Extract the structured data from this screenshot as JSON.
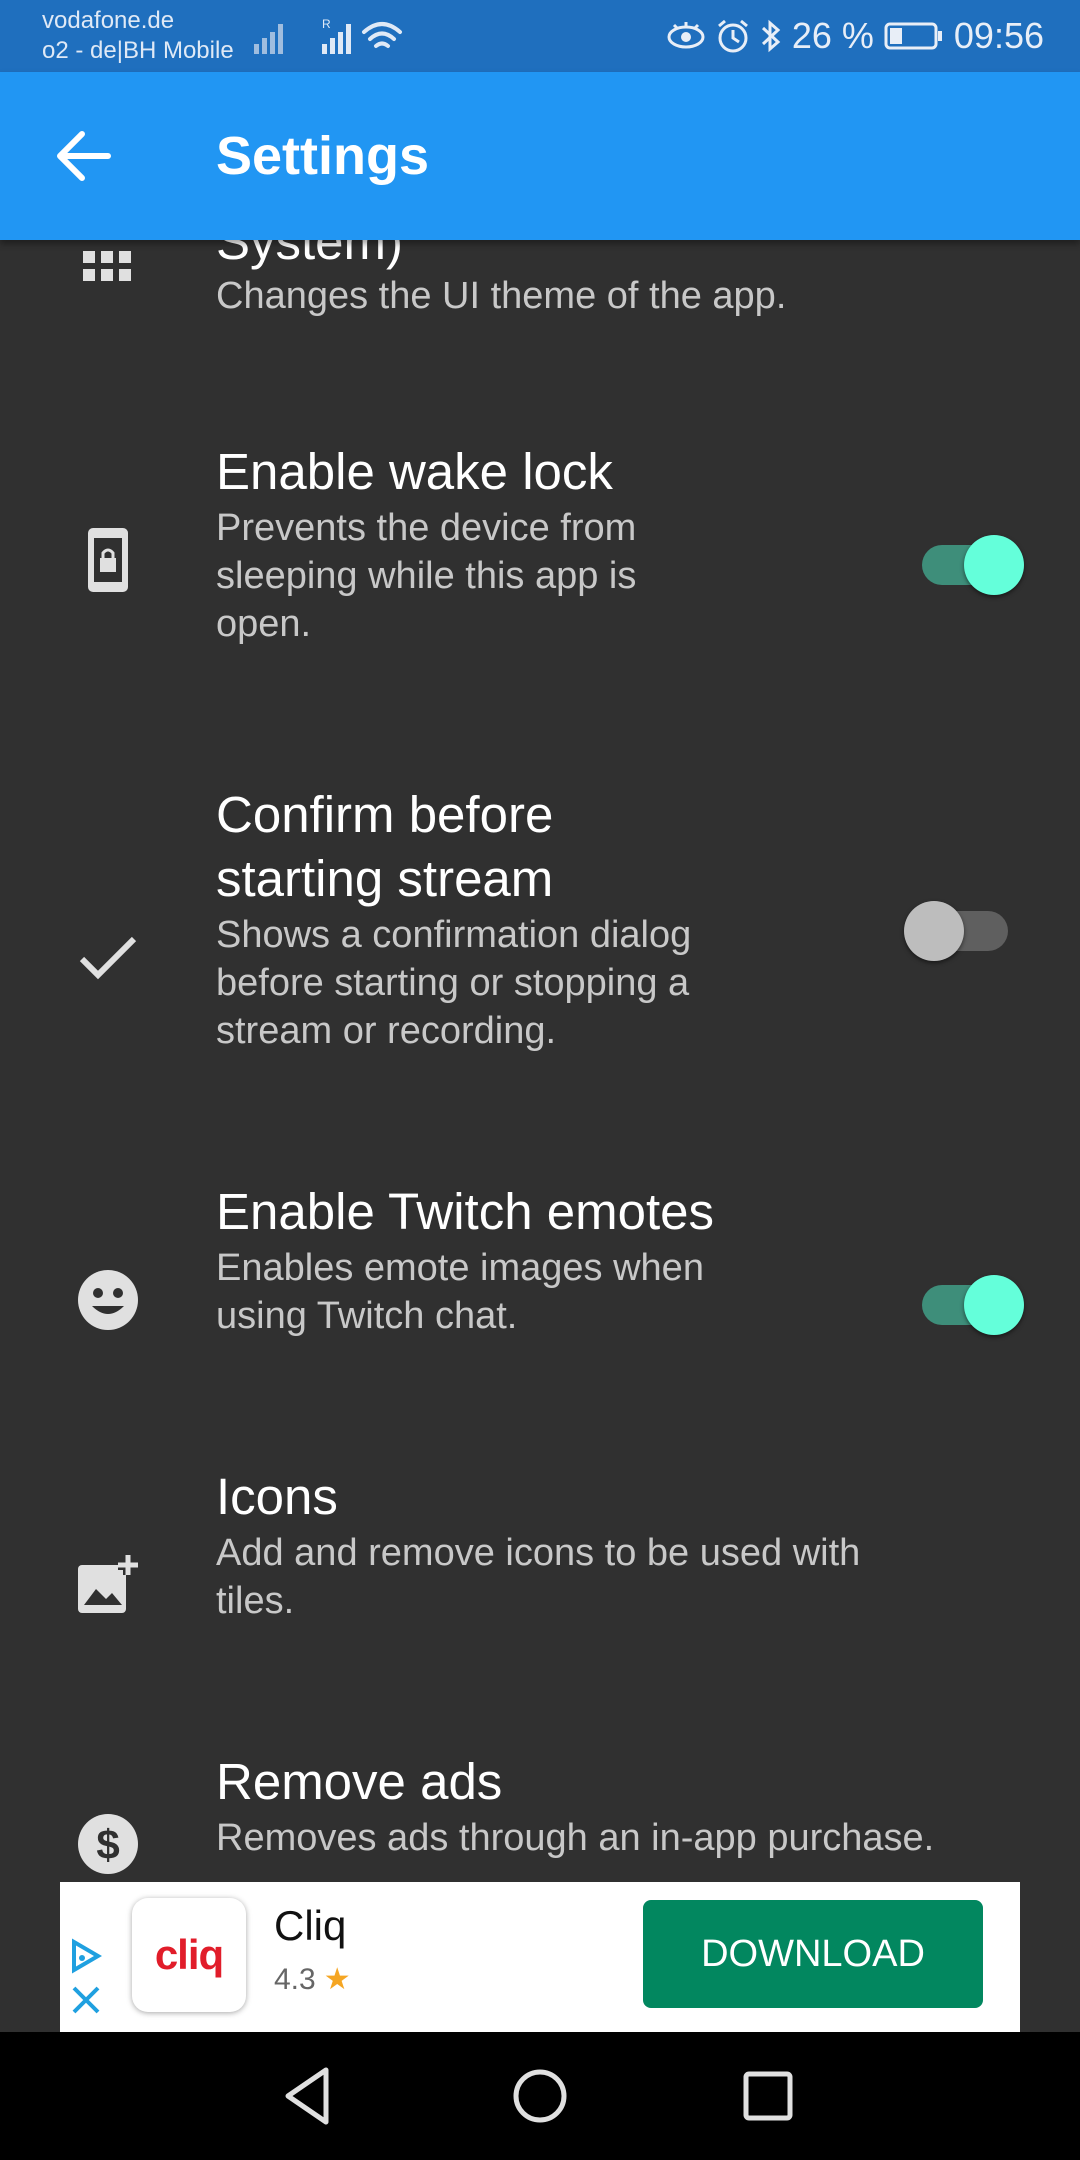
{
  "status_bar": {
    "carrier_1": "vodafone.de",
    "carrier_2": "o2 - de|BH Mobile",
    "battery_percent": "26 %",
    "time": "09:56"
  },
  "app_bar": {
    "title": "Settings",
    "color": "#2196F3"
  },
  "settings": [
    {
      "icon": "view-module-icon",
      "title": "System)",
      "summary": "Changes the UI theme of the app."
    },
    {
      "icon": "wake-lock-icon",
      "title": "Enable wake lock",
      "summary_lines": [
        "Prevents the device from",
        "sleeping while this app is",
        "open."
      ],
      "toggle_on": true
    },
    {
      "icon": "check-icon",
      "title_lines": [
        "Confirm before",
        "starting stream"
      ],
      "summary_lines": [
        "Shows a confirmation dialog",
        "before starting or stopping a",
        "stream or recording."
      ],
      "toggle_on": false
    },
    {
      "icon": "emoticon-icon",
      "title": "Enable Twitch emotes",
      "summary_lines": [
        "Enables emote images when",
        "using Twitch chat."
      ],
      "toggle_on": true
    },
    {
      "icon": "add-photo-icon",
      "title": "Icons",
      "summary_lines": [
        "Add and remove icons to be used with",
        "tiles."
      ]
    },
    {
      "icon": "dollar-icon",
      "title": "Remove ads",
      "summary": "Removes ads through an in-app purchase."
    }
  ],
  "ad": {
    "app_logo_text": "cliq",
    "app_name": "Cliq",
    "rating": "4.3",
    "button_label": "DOWNLOAD",
    "button_color": "#02875F"
  },
  "colors": {
    "background": "#303030",
    "toggle_on_thumb": "#64FFDA",
    "toggle_on_track": "#3E8E7A",
    "toggle_off_thumb": "#BDBDBD",
    "toggle_off_track": "#5F5F5F"
  }
}
